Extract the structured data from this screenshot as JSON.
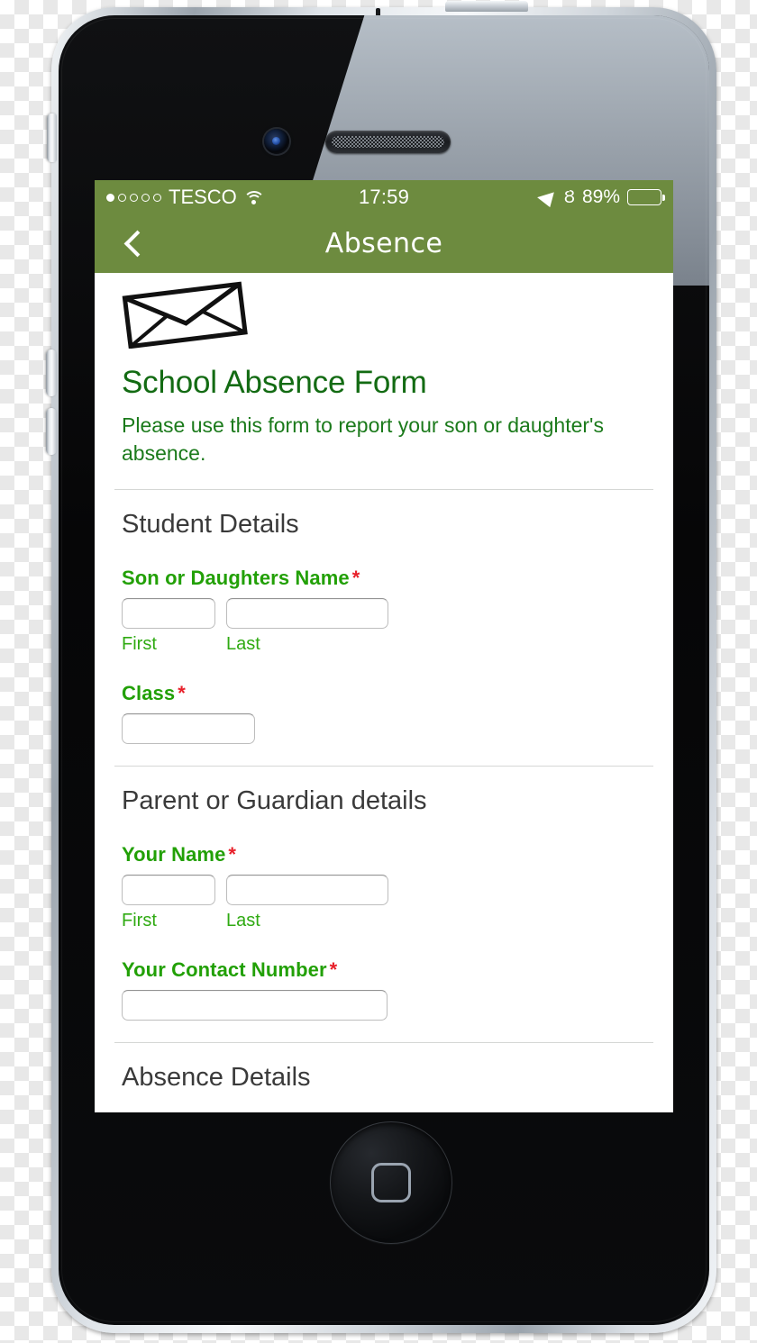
{
  "status_bar": {
    "signal_dots_total": 5,
    "signal_dots_filled": 1,
    "carrier": "TESCO",
    "wifi_icon": "wifi-icon",
    "time": "17:59",
    "location_icon": "location-arrow-icon",
    "bluetooth_icon": "bluetooth-icon",
    "bluetooth_glyph": "Ȣ",
    "battery_percent": "89%",
    "battery_level": 89
  },
  "nav_bar": {
    "back_icon": "chevron-left-icon",
    "title": "Absence",
    "background_color": "#6d8b3f"
  },
  "form": {
    "logo_icon": "envelope-icon",
    "title": "School Absence Form",
    "subtitle": "Please use this form to report your son or daughter's absence.",
    "title_color": "#136b13",
    "label_color": "#22a006",
    "required_color": "#e8202a",
    "sections": [
      {
        "heading": "Student Details",
        "fields": [
          {
            "label": "Son or Daughters Name",
            "required_marker": "*",
            "type": "name",
            "value_first": "",
            "value_last": "",
            "sublabel_first": "First",
            "sublabel_last": "Last"
          },
          {
            "label": "Class",
            "required_marker": "*",
            "type": "text",
            "value": ""
          }
        ]
      },
      {
        "heading": "Parent or Guardian details",
        "fields": [
          {
            "label": "Your Name",
            "required_marker": "*",
            "type": "name",
            "value_first": "",
            "value_last": "",
            "sublabel_first": "First",
            "sublabel_last": "Last"
          },
          {
            "label": "Your Contact Number",
            "required_marker": "*",
            "type": "text",
            "value": ""
          }
        ]
      },
      {
        "heading": "Absence Details",
        "fields": []
      }
    ]
  },
  "device": {
    "front_camera": "front-camera",
    "earpiece_speaker": "earpiece-speaker",
    "home_button": "home-button",
    "mute_switch": "mute-switch",
    "volume_up": "volume-up-button",
    "volume_down": "volume-down-button",
    "power_button": "power-button"
  }
}
